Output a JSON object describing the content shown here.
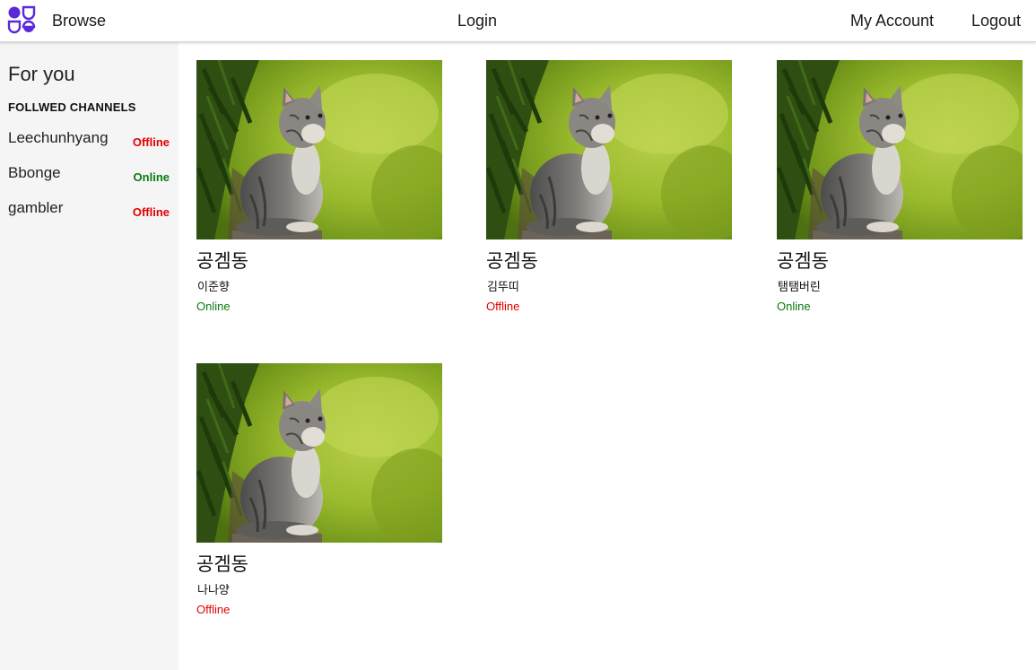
{
  "nav": {
    "browse_label": "Browse",
    "login_label": "Login",
    "account_label": "My Account",
    "logout_label": "Logout",
    "accent_color": "#5a2ad6"
  },
  "sidebar": {
    "title": "For you",
    "section_heading": "FOLLWED CHANNELS",
    "channels": [
      {
        "name": "Leechunhyang",
        "status": "Offline"
      },
      {
        "name": "Bbonge",
        "status": "Online"
      },
      {
        "name": "gambler",
        "status": "Offline"
      }
    ]
  },
  "streams": [
    {
      "title": "공겜동",
      "author": "이준향",
      "status": "Online",
      "thumbnail": "kitten-photo"
    },
    {
      "title": "공겜동",
      "author": "김뚜띠",
      "status": "Offline",
      "thumbnail": "kitten-photo"
    },
    {
      "title": "공겜동",
      "author": "탬탬버린",
      "status": "Online",
      "thumbnail": "kitten-photo"
    },
    {
      "title": "공겜동",
      "author": "나나양",
      "status": "Offline",
      "thumbnail": "kitten-photo"
    }
  ],
  "colors": {
    "online": "#0a7a12",
    "offline": "#e10000"
  }
}
